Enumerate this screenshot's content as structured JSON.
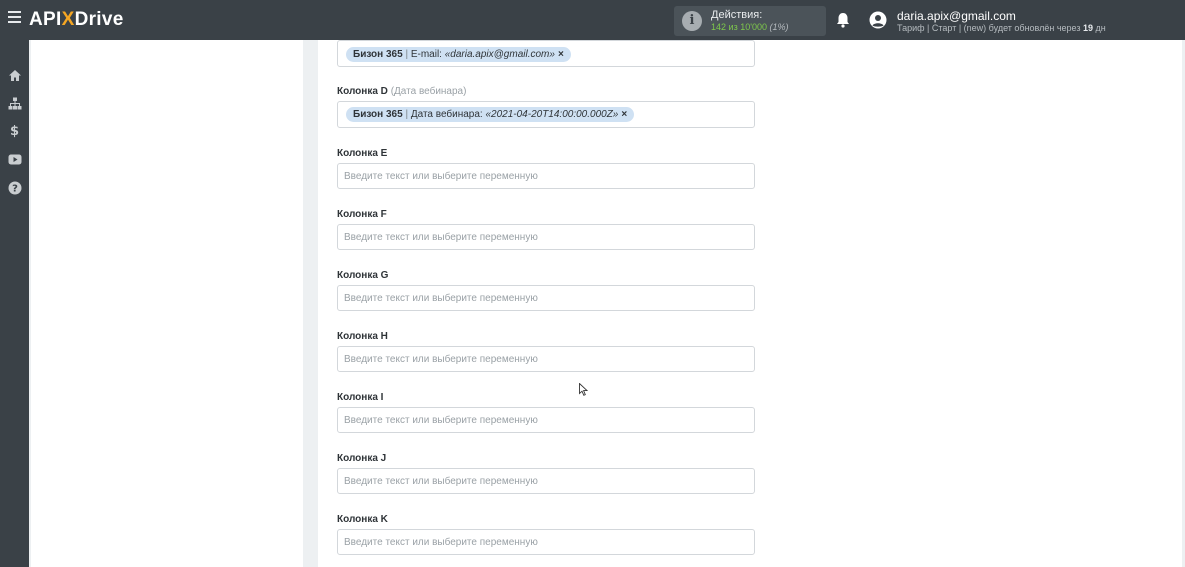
{
  "header": {
    "logo_left": "API",
    "logo_x": "X",
    "logo_right": "Drive",
    "actions_title": "Действия:",
    "actions_used": "142",
    "actions_of": "из",
    "actions_limit": "10'000",
    "actions_percent": "(1%)",
    "user_email": "daria.apix@gmail.com",
    "tariff_prefix": "Тариф | Старт | (new) будет обновлён через",
    "tariff_days": "19",
    "tariff_unit": "дн"
  },
  "sidebar": {
    "items": [
      {
        "name": "home-icon"
      },
      {
        "name": "sitemap-icon"
      },
      {
        "name": "dollar-icon"
      },
      {
        "name": "youtube-icon"
      },
      {
        "name": "help-icon"
      }
    ]
  },
  "form": {
    "email_tag": {
      "source": "Бизон 365",
      "separator": " | ",
      "field": "E-mail: ",
      "value": "«daria.apix@gmail.com»",
      "remove": "×"
    },
    "column_d": {
      "label": "Колонка D",
      "hint": "(Дата вебинара)"
    },
    "date_tag": {
      "source": "Бизон 365",
      "separator": " | ",
      "field": "Дата вебинара: ",
      "value": "«2021-04-20T14:00:00.000Z»",
      "remove": "×"
    },
    "placeholder": "Введите текст или выберите переменную",
    "columns": [
      {
        "label": "Колонка E"
      },
      {
        "label": "Колонка F"
      },
      {
        "label": "Колонка G"
      },
      {
        "label": "Колонка H"
      },
      {
        "label": "Колонка I"
      },
      {
        "label": "Колонка J"
      },
      {
        "label": "Колонка K"
      }
    ]
  },
  "colors": {
    "topbar": "#3a4147",
    "accent_orange": "#f5a623",
    "actions_green": "#7ec84b",
    "tag_bg": "#cfe1f3"
  }
}
